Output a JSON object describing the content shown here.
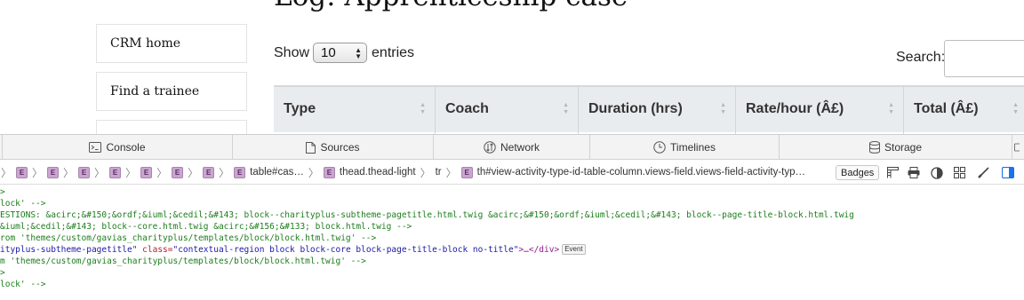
{
  "page": {
    "title": "Log: Apprenticeship case",
    "sidebar": [
      "CRM home",
      "Find a trainee"
    ],
    "show_label": "Show",
    "entries_value": "10",
    "entries_label": "entries",
    "search_label": "Search:",
    "columns": [
      "Type",
      "Coach",
      "Duration (hrs)",
      "Rate/hour (Â£)",
      "Total (Â£)"
    ]
  },
  "devtools": {
    "tabs": [
      {
        "label": "Console",
        "icon": "console-icon"
      },
      {
        "label": "Sources",
        "icon": "document-icon"
      },
      {
        "label": "Network",
        "icon": "network-icon"
      },
      {
        "label": "Timelines",
        "icon": "clock-icon"
      },
      {
        "label": "Storage",
        "icon": "database-icon"
      }
    ],
    "breadcrumb_badge": "E",
    "breadcrumbs": [
      "table#cas…",
      "thead.thead-light",
      "tr",
      "th#view-activity-type-id-table-column.views-field.views-field-activity-typ…"
    ],
    "badges_label": "Badges",
    "dom_lines": {
      "l0": ">",
      "l1": "lock' -->",
      "l2": "ESTIONS: &acirc;&#150;&ordf;&iuml;&cedil;&#143; block--charityplus-subtheme-pagetitle.html.twig &acirc;&#150;&ordf;&iuml;&cedil;&#143; block--page-title-block.html.twig",
      "l3": "&iuml;&cedil;&#143; block--core.html.twig &acirc;&#156;&#133; block.html.twig -->",
      "l4": "rom 'themes/custom/gavias_charityplus/templates/block/block.html.twig' -->",
      "l5a": "ityplus-subtheme-pagetitle\"",
      "l5b": " class=",
      "l5c": "\"contextual-region block block-core block-page-title-block no-title\"",
      "l5d": ">…</div>",
      "l5e": "Event",
      "l6": "m 'themes/custom/gavias_charityplus/templates/block/block.html.twig' -->",
      "l7": ">",
      "l8": "lock' -->"
    }
  }
}
